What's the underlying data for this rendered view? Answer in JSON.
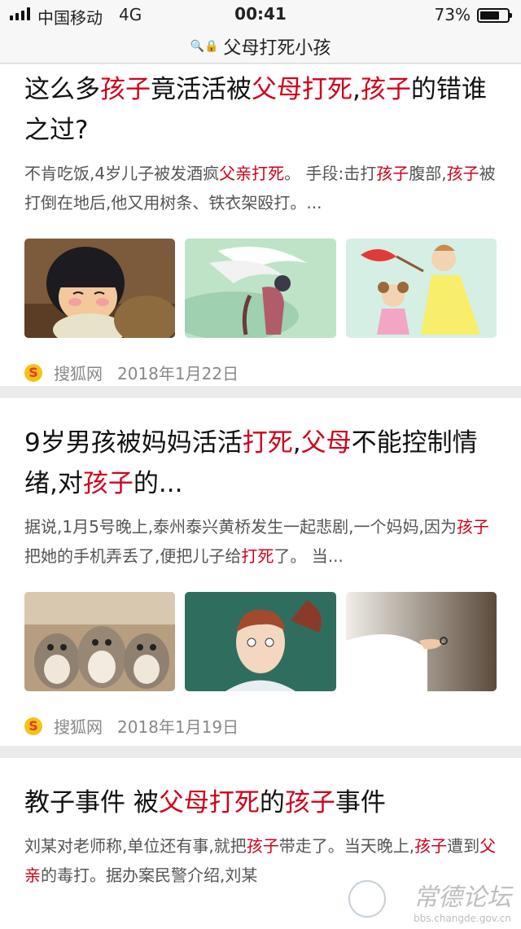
{
  "status_bar": {
    "carrier": "中国移动",
    "network": "4G",
    "time": "00:41",
    "battery": "73%",
    "battery_level": 0.73
  },
  "url_bar": {
    "query": "父母打死小孩",
    "icons": [
      "search-icon",
      "lock-icon"
    ]
  },
  "results": [
    {
      "title": [
        {
          "t": "这么多",
          "h": false
        },
        {
          "t": "孩子",
          "h": true
        },
        {
          "t": "竟活活被",
          "h": false
        },
        {
          "t": "父母打死",
          "h": true
        },
        {
          "t": ",",
          "h": false
        },
        {
          "t": "孩子",
          "h": true
        },
        {
          "t": "的错谁之过?",
          "h": false
        }
      ],
      "snippet": [
        {
          "t": "不肯吃饭,4岁儿子被发酒疯",
          "h": false
        },
        {
          "t": "父亲打死",
          "h": true
        },
        {
          "t": "。 手段:击打",
          "h": false
        },
        {
          "t": "孩子",
          "h": true
        },
        {
          "t": "腹部,",
          "h": false
        },
        {
          "t": "孩子",
          "h": true
        },
        {
          "t": "被打倒在地后,他又用树条、铁衣架殴打。...",
          "h": false
        }
      ],
      "images": [
        "crying-boy-anime-image",
        "winged-figure-illustration-image",
        "mother-scolding-girl-illustration-image"
      ],
      "source": "搜狐网",
      "date": "2018年1月22日"
    },
    {
      "title": [
        {
          "t": "9岁男孩被妈妈活活",
          "h": false
        },
        {
          "t": "打死",
          "h": true
        },
        {
          "t": ",",
          "h": false
        },
        {
          "t": "父母",
          "h": true
        },
        {
          "t": "不能控制情绪,对",
          "h": false
        },
        {
          "t": "孩子",
          "h": true
        },
        {
          "t": "的...",
          "h": false
        }
      ],
      "snippet": [
        {
          "t": "据说,1月5号晚上,泰州泰兴黄桥发生一起悲剧,一个妈妈,因为",
          "h": false
        },
        {
          "t": "孩子",
          "h": true
        },
        {
          "t": "把她的手机弄丢了,便把儿子给",
          "h": false
        },
        {
          "t": "打死",
          "h": true
        },
        {
          "t": "了。 当...",
          "h": false
        }
      ],
      "images": [
        "totoro-figurines-image",
        "man-head-illustration-image",
        "meditation-hand-image"
      ],
      "source": "搜狐网",
      "date": "2018年1月19日"
    },
    {
      "title": [
        {
          "t": "教子事件 被",
          "h": false
        },
        {
          "t": "父母打死",
          "h": true
        },
        {
          "t": "的",
          "h": false
        },
        {
          "t": "孩子",
          "h": true
        },
        {
          "t": "事件",
          "h": false
        }
      ],
      "snippet": [
        {
          "t": "刘某对老师称,单位还有事,就把",
          "h": false
        },
        {
          "t": "孩子",
          "h": true
        },
        {
          "t": "带走了。当天晚上,",
          "h": false
        },
        {
          "t": "孩子",
          "h": true
        },
        {
          "t": "遭到",
          "h": false
        },
        {
          "t": "父亲",
          "h": true
        },
        {
          "t": "的毒打。据办案民警介绍,刘某",
          "h": false
        }
      ]
    }
  ],
  "watermark": {
    "text": "常德论坛",
    "url": "bbs.changde.gov.cn"
  },
  "colors": {
    "highlight": "#d0021b",
    "snippet": "#555555",
    "meta": "#888888",
    "divider": "#ebebeb"
  }
}
